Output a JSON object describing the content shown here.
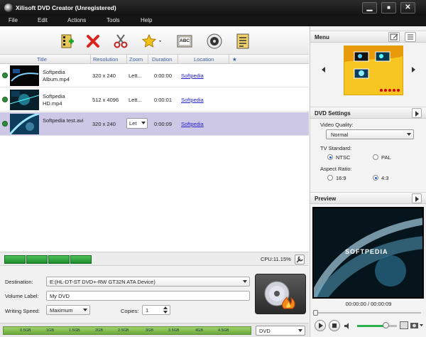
{
  "window": {
    "title": "Xilisoft DVD Creator (Unregistered)",
    "minimize": "▁",
    "maximize": "■",
    "close": "✕"
  },
  "menubar": [
    "File",
    "Edit",
    "Actions",
    "Tools",
    "Help"
  ],
  "toolbar": {
    "icons": [
      "add-file-icon",
      "delete-icon",
      "cut-icon",
      "effects-icon",
      "subtitle-icon",
      "audio-icon",
      "properties-icon"
    ],
    "subtitle_badge": "ABC"
  },
  "columns": {
    "title": "Title",
    "resolution": "Resolution",
    "zoom": "Zoom",
    "duration": "Duration",
    "location": "Location",
    "star": "★"
  },
  "rows": [
    {
      "title": "Softpedia Album.mp4",
      "resolution": "320 x 240",
      "zoom": "Lett...",
      "duration": "0:00:00",
      "location": "Softpedia"
    },
    {
      "title": "Softpedia HD.mp4",
      "resolution": "512 x 4096",
      "zoom": "Lett...",
      "duration": "0:00:01",
      "location": "Softpedia"
    },
    {
      "title": "Softpedia test.avi",
      "resolution": "320 x 240",
      "zoom": "Let",
      "duration": "0:00:09",
      "location": "Softpedia"
    }
  ],
  "status": {
    "cpu": "CPU:11.15%"
  },
  "output": {
    "destination_label": "Destination:",
    "destination_value": "E:(HL-DT-ST DVD+-RW GT32N ATA Device)",
    "volume_label": "Volume Label:",
    "volume_value": "My DVD",
    "speed_label": "Writing Speed:",
    "speed_value": "Maximum",
    "copies_label": "Copies:",
    "copies_value": "1"
  },
  "capacity": {
    "ticks": [
      "0.5GB",
      "1GB",
      "1.5GB",
      "2GB",
      "2.5GB",
      "3GB",
      "3.5GB",
      "4GB",
      "4.5GB"
    ],
    "disc_type": "DVD"
  },
  "menu_panel": {
    "title": "Menu"
  },
  "dvd_settings": {
    "title": "DVD Settings",
    "quality_label": "Video Quality:",
    "quality_value": "Normal",
    "tv_label": "TV Standard:",
    "ntsc": "NTSC",
    "pal": "PAL",
    "aspect_label": "Aspect Ratio:",
    "a169": "16:9",
    "a43": "4:3"
  },
  "preview": {
    "title": "Preview",
    "timecode": "00:00:00 / 00:00:09",
    "watermark": "SOFTPEDIA"
  },
  "colors": {
    "selected_row": "#ccc8e6",
    "link": "#2222cc",
    "menu_bg": "#f7c623"
  }
}
